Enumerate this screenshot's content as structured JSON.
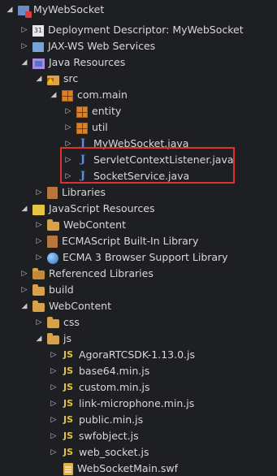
{
  "tree": {
    "top_fragment": "",
    "items": [
      {
        "label": "MyWebSocket",
        "icon": "project-icon",
        "arrow": "down"
      },
      {
        "label": "Deployment Descriptor: MyWebSocket",
        "icon": "descriptor-icon",
        "arrow": "right"
      },
      {
        "label": "JAX-WS Web Services",
        "icon": "webservices-icon",
        "arrow": "right"
      },
      {
        "label": "Java Resources",
        "icon": "java-resources-icon",
        "arrow": "down"
      },
      {
        "label": "src",
        "icon": "source-folder-icon",
        "arrow": "down"
      },
      {
        "label": "com.main",
        "icon": "package-icon",
        "arrow": "down"
      },
      {
        "label": "entity",
        "icon": "package-icon",
        "arrow": "right"
      },
      {
        "label": "util",
        "icon": "package-icon",
        "arrow": "right"
      },
      {
        "label": "MyWebSocket.java",
        "icon": "java-file-icon",
        "arrow": "right"
      },
      {
        "label": "ServletContextListener.java",
        "icon": "java-file-icon",
        "arrow": "right"
      },
      {
        "label": "SocketService.java",
        "icon": "java-file-icon",
        "arrow": "right"
      },
      {
        "label": "Libraries",
        "icon": "library-icon",
        "arrow": "right"
      },
      {
        "label": "JavaScript Resources",
        "icon": "js-resources-icon",
        "arrow": "down"
      },
      {
        "label": "WebContent",
        "icon": "js-folder-icon",
        "arrow": "right"
      },
      {
        "label": "ECMAScript Built-In Library",
        "icon": "library-icon",
        "arrow": "right"
      },
      {
        "label": "ECMA 3 Browser Support Library",
        "icon": "globe-icon",
        "arrow": "right"
      },
      {
        "label": "Referenced Libraries",
        "icon": "library-folder-icon",
        "arrow": "right"
      },
      {
        "label": "build",
        "icon": "folder-icon",
        "arrow": "right"
      },
      {
        "label": "WebContent",
        "icon": "folder-icon",
        "arrow": "down"
      },
      {
        "label": "css",
        "icon": "folder-icon",
        "arrow": "right"
      },
      {
        "label": "js",
        "icon": "folder-icon",
        "arrow": "down"
      },
      {
        "label": "AgoraRTCSDK-1.13.0.js",
        "icon": "js-file-icon",
        "arrow": "right"
      },
      {
        "label": "base64.min.js",
        "icon": "js-file-icon",
        "arrow": "right"
      },
      {
        "label": "custom.min.js",
        "icon": "js-file-icon",
        "arrow": "right"
      },
      {
        "label": "link-microphone.min.js",
        "icon": "js-file-icon",
        "arrow": "right"
      },
      {
        "label": "public.min.js",
        "icon": "js-file-icon",
        "arrow": "right"
      },
      {
        "label": "swfobject.js",
        "icon": "js-file-icon",
        "arrow": "right"
      },
      {
        "label": "web_socket.js",
        "icon": "js-file-icon",
        "arrow": "right"
      },
      {
        "label": "WebSocketMain.swf",
        "icon": "swf-file-icon",
        "arrow": ""
      }
    ]
  },
  "colors": {
    "background": "#1e1f22",
    "highlight": "#e23030"
  }
}
